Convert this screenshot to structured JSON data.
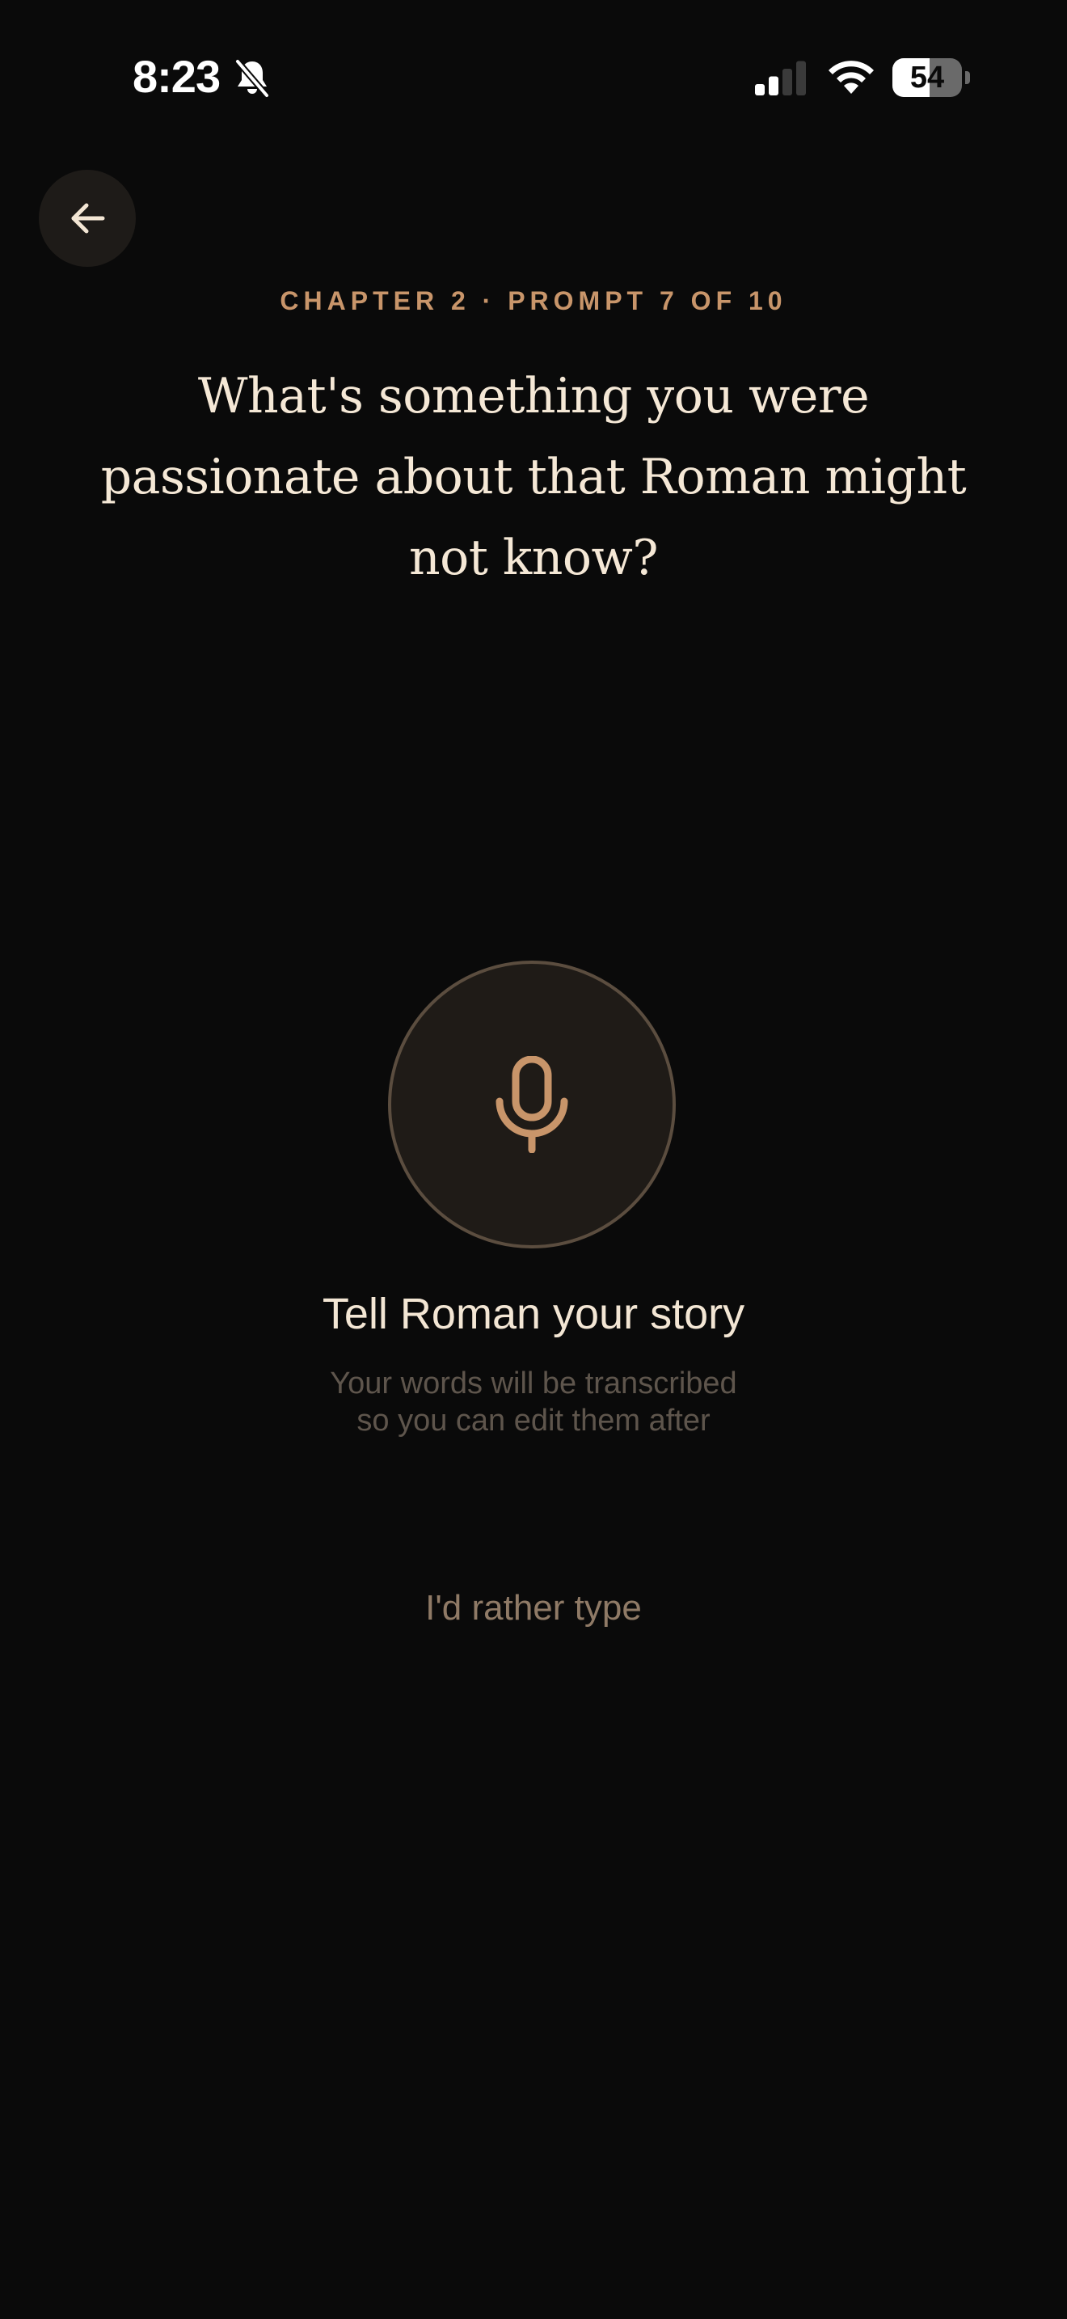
{
  "status_bar": {
    "time": "8:23",
    "battery_level": "54",
    "battery_fraction": 0.54,
    "signal_bars_active": 2,
    "signal_bars_total": 4
  },
  "icons": {
    "back": "arrow-left-icon",
    "mic": "microphone-icon",
    "bell": "bell-slash-icon",
    "signal": "cellular-signal-icon",
    "wifi": "wifi-icon"
  },
  "colors": {
    "background": "#0a0a0a",
    "accent": "#c8956a",
    "heading": "#f5e8d6",
    "muted": "#5e554c",
    "link": "#8f7a66"
  },
  "header": {
    "chapter_label": "CHAPTER 2 · PROMPT 7 OF 10"
  },
  "prompt": {
    "question": "What's something you were passionate about that Roman might not know?"
  },
  "recorder": {
    "title": "Tell Roman your story",
    "subtitle_line1": "Your words will be transcribed",
    "subtitle_line2": "so you can edit them after"
  },
  "actions": {
    "type_instead": "I'd rather type"
  }
}
